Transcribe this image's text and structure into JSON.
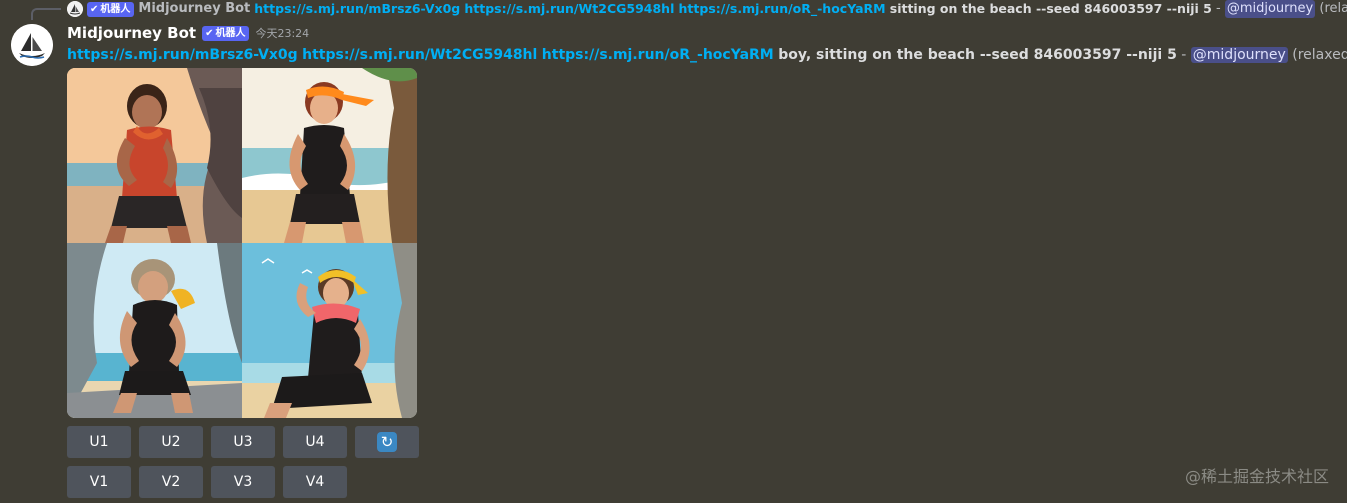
{
  "reply": {
    "badge_label": "机器人",
    "author": "Midjourney Bot",
    "links": [
      "https://s.mj.run/mBrsz6-Vx0g",
      "https://s.mj.run/Wt2CG5948hl",
      "https://s.mj.run/oR_-hocYaRM"
    ],
    "prompt": "sitting on the beach --seed 846003597 --niji 5",
    "separator": "-",
    "mention": "@midjourney",
    "status": "(relaxed)"
  },
  "message": {
    "author": "Midjourney Bot",
    "badge_label": "机器人",
    "timestamp": "今天23:24",
    "links": [
      "https://s.mj.run/mBrsz6-Vx0g",
      "https://s.mj.run/Wt2CG5948hl",
      "https://s.mj.run/oR_-hocYaRM"
    ],
    "prompt": "boy, sitting on the beach --seed 846003597 --niji 5",
    "separator": "-",
    "mention": "@midjourney",
    "status": "(relaxed)"
  },
  "buttons": {
    "upscale": [
      "U1",
      "U2",
      "U3",
      "U4"
    ],
    "variation": [
      "V1",
      "V2",
      "V3",
      "V4"
    ],
    "reroll_icon": "refresh-icon"
  },
  "watermark": "@稀土掘金技术社区",
  "colors": {
    "background": "#3f3d34",
    "link": "#00aff4",
    "badge": "#5865f2",
    "button": "#4f545c",
    "reroll": "#3b88c3"
  }
}
